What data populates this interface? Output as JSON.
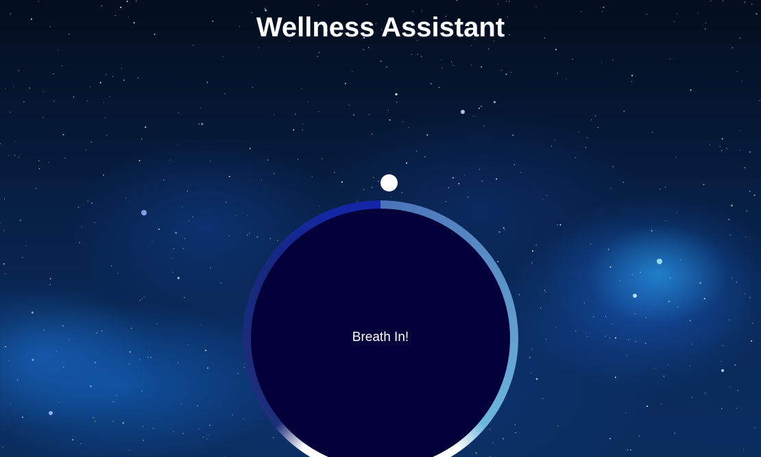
{
  "header": {
    "title": "Wellness Assistant"
  },
  "breathing": {
    "instruction": "Breath In!"
  },
  "colors": {
    "circle_fill": "#04003a",
    "ring_inhale": "#1426a6",
    "ring_hold": "#6cb6dd",
    "ring_exhale": "#ffffff",
    "pointer": "#ffffff"
  }
}
